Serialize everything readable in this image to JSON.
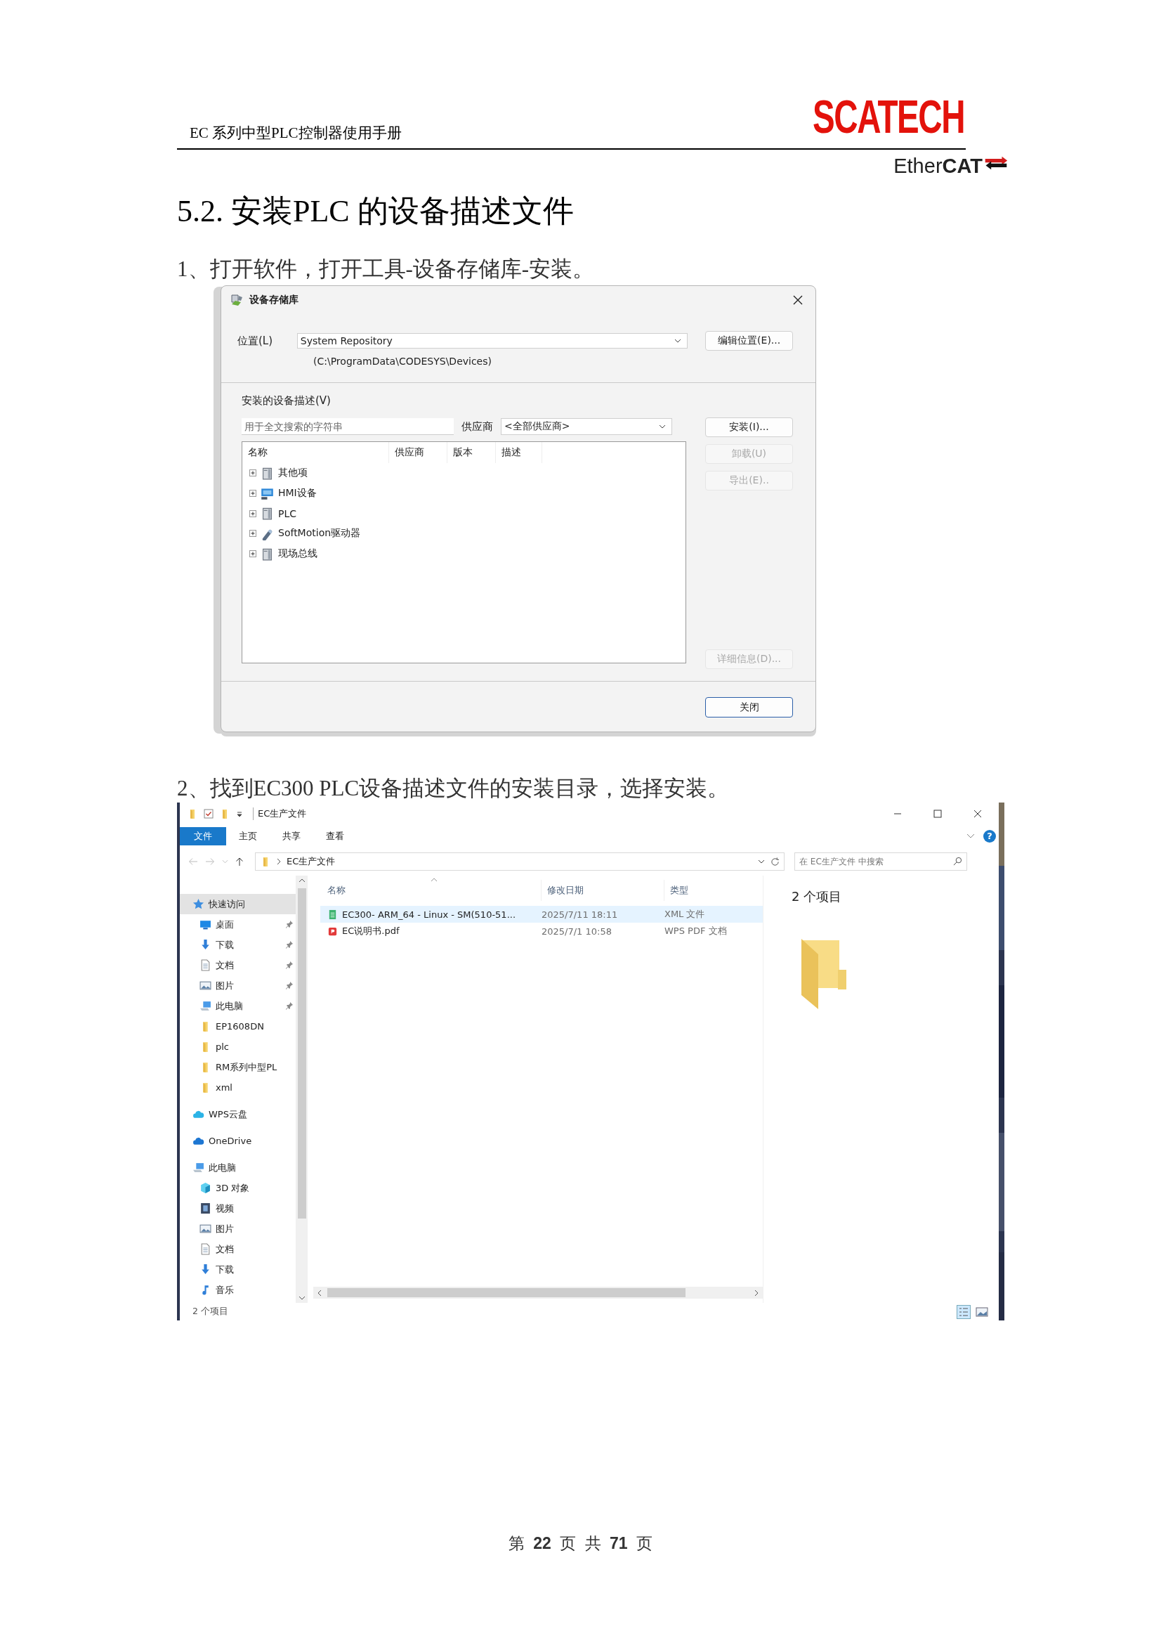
{
  "header": {
    "title": "EC 系列中型PLC控制器使用手册",
    "logo": "SCATECH",
    "ethercat": "Ether**CAT**"
  },
  "heading": "5.2. 安装PLC 的设备描述文件",
  "step_1": "1、打开软件，打开工具-设备存储库-安装。",
  "repository_dialog": {
    "title": "设备存储库",
    "location_label": "位置(L)",
    "location": "System Repository",
    "location_path": "(C:\\ProgramData\\CODESYS\\Devices)",
    "edit_location_button": "编辑位置(E)...",
    "installed_label": "安装的设备描述(V)",
    "search_placeholder": "用于全文搜索的字符串",
    "vendor_label": "供应商",
    "vendor": "<全部供应商>",
    "columns": [
      "名称",
      "供应商",
      "版本",
      "描述"
    ],
    "tree": [
      {
        "label": "其他项",
        "kind": "cabinet",
        "expanded": false
      },
      {
        "label": "HMI设备",
        "kind": "screen",
        "expanded": false
      },
      {
        "label": "PLC",
        "kind": "cabinet",
        "expanded": false
      },
      {
        "label": "SoftMotion驱动器",
        "kind": "drive",
        "expanded": false
      },
      {
        "label": "现场总线",
        "kind": "cabinet",
        "expanded": false
      }
    ],
    "side_buttons": [
      {
        "label": "安装(I)...",
        "disabled": false
      },
      {
        "label": "卸载(U)",
        "disabled": true
      },
      {
        "label": "导出(E)..",
        "disabled": true
      }
    ],
    "details_button": {
      "label": "详细信息(D)...",
      "disabled": true
    },
    "close_button": "关闭"
  },
  "step_2": "2、找到EC300 PLC设备描述文件的安装目录，选择安装。",
  "explorer": {
    "title": "EC生产文件",
    "ribbon": [
      {
        "label": "文件",
        "kind": "menu"
      },
      {
        "label": "主页",
        "kind": "tab"
      },
      {
        "label": "共享",
        "kind": "tab"
      },
      {
        "label": "查看",
        "kind": "tab"
      }
    ],
    "help": "?",
    "address": "EC生产文件",
    "search_placeholder": "在 EC生产文件 中搜索",
    "columns": [
      "名称",
      "修改日期",
      "类型"
    ],
    "files": [
      {
        "name": "EC300- ARM_64 - Linux - SM(510-51...",
        "date": "2025/7/11 18:11",
        "type": "XML 文件",
        "kind": "xml",
        "selected": true
      },
      {
        "name": "EC说明书.pdf",
        "date": "2025/7/1 10:58",
        "type": "WPS PDF 文档",
        "kind": "pdf",
        "selected": false
      }
    ],
    "nav": [
      {
        "label": "快速访问",
        "kind": "star",
        "selected": true,
        "children": [
          {
            "label": "桌面",
            "kind": "desktop",
            "pinned": true,
            "selected": false
          },
          {
            "label": "下载",
            "kind": "download",
            "pinned": true,
            "selected": false
          },
          {
            "label": "文档",
            "kind": "document",
            "pinned": true,
            "selected": false
          },
          {
            "label": "图片",
            "kind": "picture",
            "pinned": true,
            "selected": false
          },
          {
            "label": "此电脑",
            "kind": "computer",
            "pinned": true,
            "selected": false
          },
          {
            "label": "EP1608DN",
            "kind": "folder",
            "pinned": false,
            "selected": false
          },
          {
            "label": "plc",
            "kind": "folder",
            "pinned": false,
            "selected": false
          },
          {
            "label": "RM系列中型PL",
            "kind": "folder",
            "pinned": false,
            "selected": false
          },
          {
            "label": "xml",
            "kind": "folder",
            "pinned": false,
            "selected": false
          }
        ]
      },
      {
        "label": "WPS云盘",
        "kind": "wps_cloud",
        "selected": false
      },
      {
        "label": "OneDrive",
        "kind": "onedrive",
        "selected": false
      },
      {
        "label": "此电脑",
        "kind": "computer",
        "selected": false,
        "children": [
          {
            "label": "3D 对象",
            "kind": "cube",
            "pinned": false,
            "selected": false
          },
          {
            "label": "视频",
            "kind": "film",
            "pinned": false,
            "selected": false
          },
          {
            "label": "图片",
            "kind": "picture",
            "pinned": false,
            "selected": false
          },
          {
            "label": "文档",
            "kind": "document",
            "pinned": false,
            "selected": false
          },
          {
            "label": "下载",
            "kind": "download",
            "pinned": false,
            "selected": false
          },
          {
            "label": "音乐",
            "kind": "music",
            "pinned": false,
            "selected": false
          }
        ]
      }
    ],
    "preview_count": "2 个项目",
    "status": "2 个项目"
  },
  "footer": "第 **22** 页 共 **71** 页"
}
